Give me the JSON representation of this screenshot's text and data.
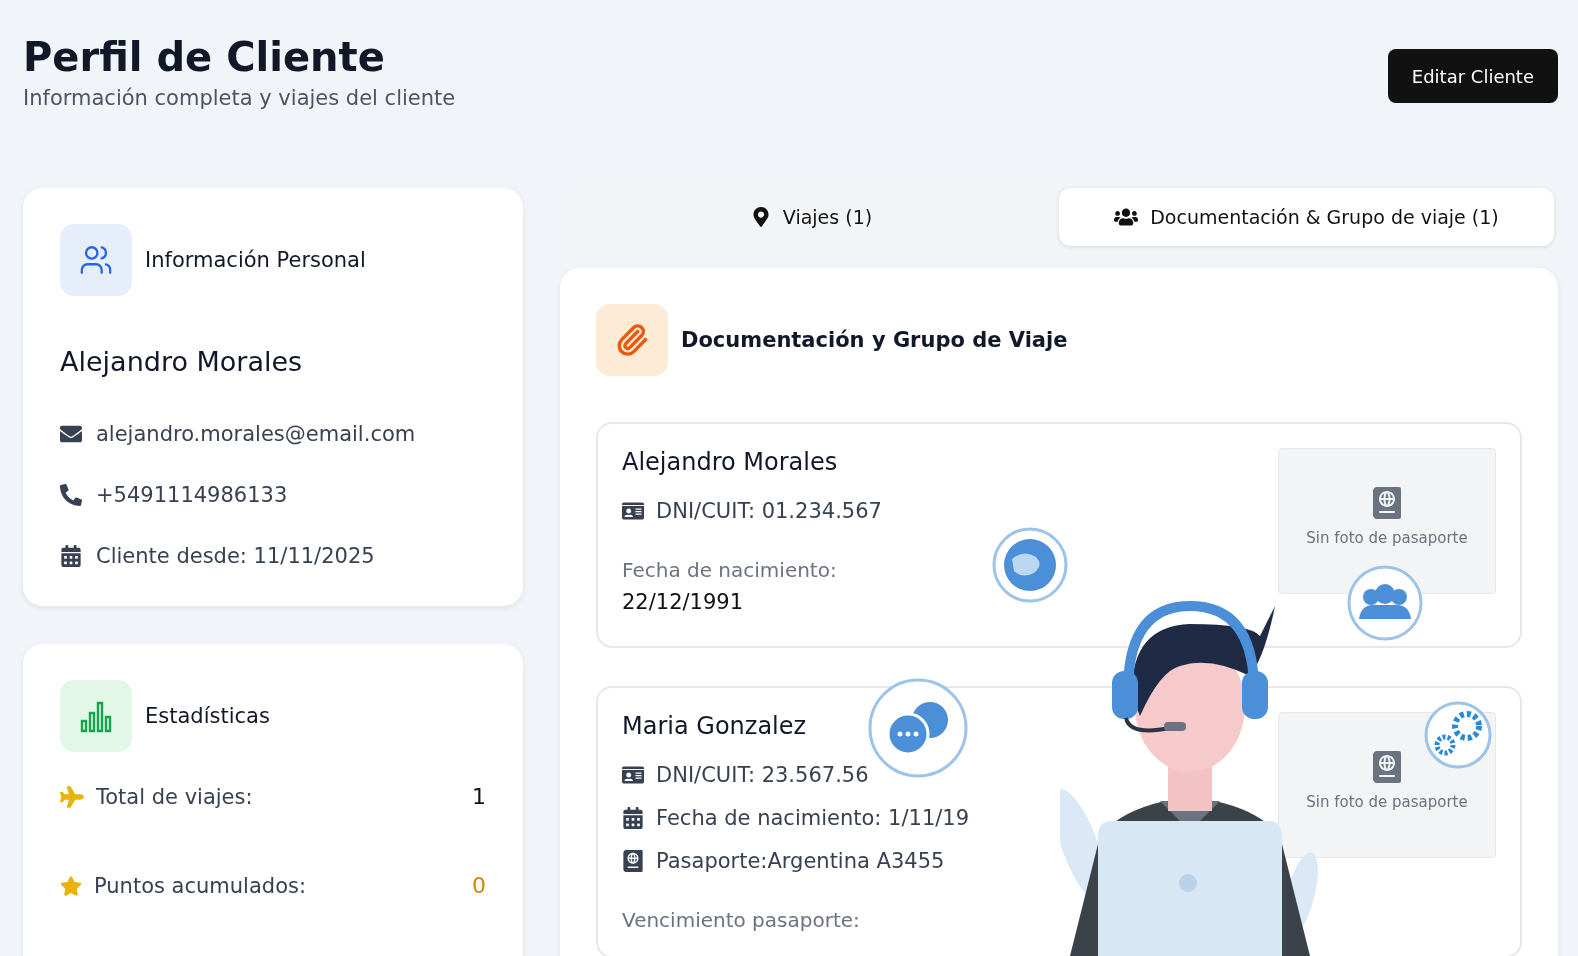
{
  "header": {
    "title": "Perfil de Cliente",
    "subtitle": "Información completa y viajes del cliente",
    "edit_button": "Editar Cliente"
  },
  "personal": {
    "title": "Información Personal",
    "name": "Alejandro Morales",
    "contacts": [
      {
        "kind": "email",
        "text": "alejandro.morales@email.com"
      },
      {
        "kind": "phone",
        "text": "+5491114986133"
      },
      {
        "kind": "calendar",
        "text": "Cliente desde: 11/11/2025"
      }
    ]
  },
  "stats": {
    "title": "Estadísticas",
    "rows": [
      {
        "kind": "trips",
        "label": "Total de viajes:",
        "value": "1"
      },
      {
        "kind": "points",
        "label": "Puntos acumulados:",
        "value": "0"
      }
    ]
  },
  "tabs": [
    {
      "label": "Viajes (1)",
      "selected": false
    },
    {
      "label": "Documentación & Grupo de viaje (1)",
      "selected": true
    }
  ],
  "documents": {
    "title": "Documentación y Grupo de Viaje",
    "members": [
      {
        "name": "Alejandro Morales",
        "photo_placeholder": "Sin foto de pasaporte",
        "fields": [
          {
            "kind": "id",
            "text": "DNI/CUIT: 01.234.567"
          },
          {
            "kind": "label",
            "text": "Fecha de nacimiento:"
          },
          {
            "kind": "value",
            "text": "22/12/1991"
          }
        ]
      },
      {
        "name": "Maria Gonzalez",
        "photo_placeholder": "Sin foto de pasaporte",
        "fields": [
          {
            "kind": "id",
            "text": "DNI/CUIT: 23.567.56"
          },
          {
            "kind": "birth",
            "text": "Fecha de nacimiento: 1/11/19"
          },
          {
            "kind": "passport",
            "text": "Pasaporte:Argentina A3455"
          },
          {
            "kind": "label",
            "text": "Vencimiento pasaporte:"
          }
        ]
      }
    ]
  }
}
